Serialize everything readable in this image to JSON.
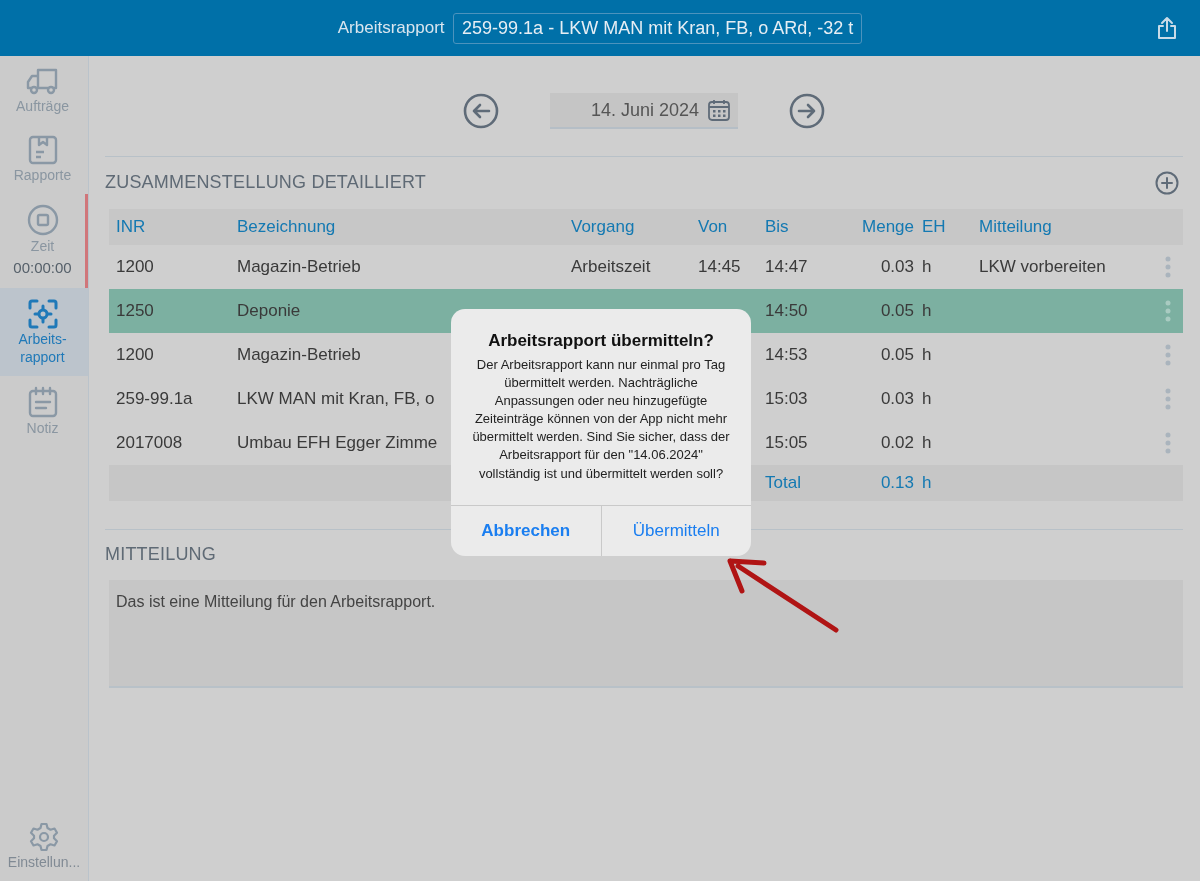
{
  "header": {
    "title": "Arbeitsrapport",
    "order": "259-99.1a - LKW MAN mit Kran, FB, o ARd, -32 t"
  },
  "sidebar": {
    "items": [
      {
        "label": "Aufträge",
        "selected": false,
        "flagged": false
      },
      {
        "label": "Rapporte",
        "selected": false,
        "flagged": false
      },
      {
        "label": "Zeit",
        "timer": "00:00:00",
        "selected": false,
        "flagged": true
      },
      {
        "label": "Arbeits-rapport",
        "selected": true,
        "flagged": false
      },
      {
        "label": "Notiz",
        "selected": false,
        "flagged": false
      }
    ],
    "footer": {
      "label": "Einstellun..."
    }
  },
  "date": "14. Juni 2024",
  "summary": {
    "title": "ZUSAMMENSTELLUNG DETAILLIERT",
    "columns": [
      "INR",
      "Bezeichnung",
      "Vorgang",
      "Von",
      "Bis",
      "Menge",
      "EH",
      "Mitteilung"
    ],
    "rows": [
      {
        "inr": "1200",
        "bezeichnung": "Magazin-Betrieb",
        "vorgang": "Arbeitszeit",
        "von": "14:45",
        "bis": "14:47",
        "menge": "0.03",
        "eh": "h",
        "mitteilung": "LKW vorbereiten",
        "selected": false
      },
      {
        "inr": "1250",
        "bezeichnung": "Deponie",
        "bis": "14:50",
        "menge": "0.05",
        "eh": "h",
        "selected": true
      },
      {
        "inr": "1200",
        "bezeichnung": "Magazin-Betrieb",
        "bis": "14:53",
        "menge": "0.05",
        "eh": "h",
        "selected": false
      },
      {
        "inr": "259-99.1a",
        "bezeichnung": "LKW MAN mit Kran, FB, o",
        "bis": "15:03",
        "menge": "0.03",
        "eh": "h",
        "selected": false
      },
      {
        "inr": "2017008",
        "bezeichnung": "Umbau EFH Egger Zimme",
        "bis": "15:05",
        "menge": "0.02",
        "eh": "h",
        "selected": false
      }
    ],
    "total": {
      "label": "Total",
      "menge": "0.13",
      "eh": "h"
    }
  },
  "message": {
    "title": "MITTEILUNG",
    "value": "Das ist eine Mitteilung für den Arbeitsrapport."
  },
  "dialog": {
    "title": "Arbeitsrapport übermitteln?",
    "text": "Der Arbeitsrapport kann nur einmal pro Tag übermittelt werden. Nachträgliche Anpassungen oder neu hinzugefügte Zeiteinträge können von der App nicht mehr übermittelt werden. Sind Sie sicher, dass der Arbeitsrapport für den \"14.06.2024\" vollständig ist und übermittelt werden soll?",
    "buttons": [
      {
        "label": "Abbrechen",
        "kind": "cancel"
      },
      {
        "label": "Übermitteln",
        "kind": "default"
      }
    ]
  }
}
